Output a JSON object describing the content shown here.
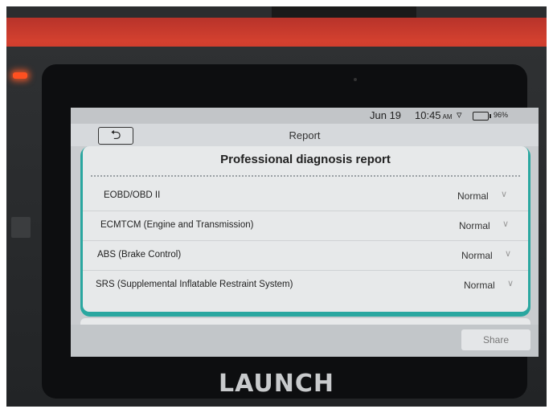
{
  "device": {
    "brand": "LAUNCH"
  },
  "status_bar": {
    "date": "Jun 19",
    "time": "10:45",
    "ampm": "AM",
    "battery": "96%"
  },
  "nav": {
    "back_icon": "back-arrow-icon",
    "title": "Report"
  },
  "report": {
    "title": "Professional diagnosis report",
    "rows": [
      {
        "label": "EOBD/OBD II",
        "status": "Normal"
      },
      {
        "label": "ECMTCM (Engine and Transmission)",
        "status": "Normal"
      },
      {
        "label": "ABS (Brake Control)",
        "status": "Normal"
      },
      {
        "label": "SRS (Supplemental Inflatable Restraint System)",
        "status": "Normal"
      }
    ]
  },
  "actions": {
    "share": "Share"
  },
  "colors": {
    "accent": "#2aa7a0",
    "device_red": "#d2402f"
  }
}
